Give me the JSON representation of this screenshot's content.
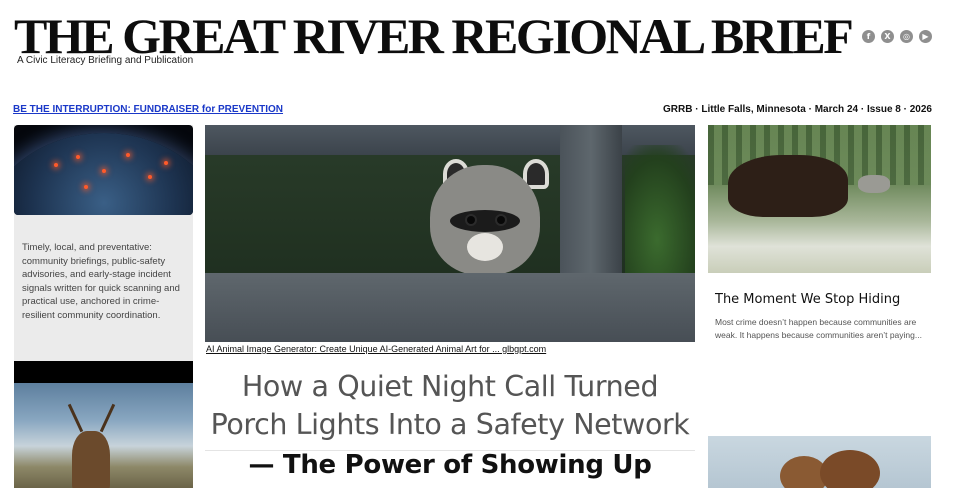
{
  "masthead": {
    "title": "THE GREAT RIVER REGIONAL BRIEF",
    "subtitle": "A Civic Literacy Briefing and Publication"
  },
  "social": [
    {
      "icon": "facebook-icon",
      "glyph": "f"
    },
    {
      "icon": "x-icon",
      "glyph": "X"
    },
    {
      "icon": "instagram-icon",
      "glyph": "◎"
    },
    {
      "icon": "youtube-icon",
      "glyph": "▶"
    }
  ],
  "topbar": {
    "fundraiser_link": "BE THE INTERRUPTION: FUNDRAISER for PREVENTION",
    "issue_info": "GRRB · Little Falls, Minnesota · March 24 · Issue 8 · 2026"
  },
  "left": {
    "description": "Timely, local, and preventative: community briefings, public-safety advisories, and early-stage incident signals written for quick scanning and practical use, anchored in crime-resilient community coordination."
  },
  "feature": {
    "image_caption": "AI Animal Image Generator: Create Unique AI-Generated Animal Art for ... glbgpt.com",
    "headline": "How a Quiet Night Call Turned Porch Lights Into a Safety Network",
    "subheadline": "— The Power of Showing Up"
  },
  "right": {
    "story_title": "The Moment We Stop Hiding",
    "story_excerpt": "Most crime doesn’t happen because communities are weak. It happens because communities aren’t paying..."
  },
  "colors": {
    "link_blue": "#1a38c8",
    "panel_gray": "#ebebeb",
    "icon_gray": "#8f8f8f"
  }
}
